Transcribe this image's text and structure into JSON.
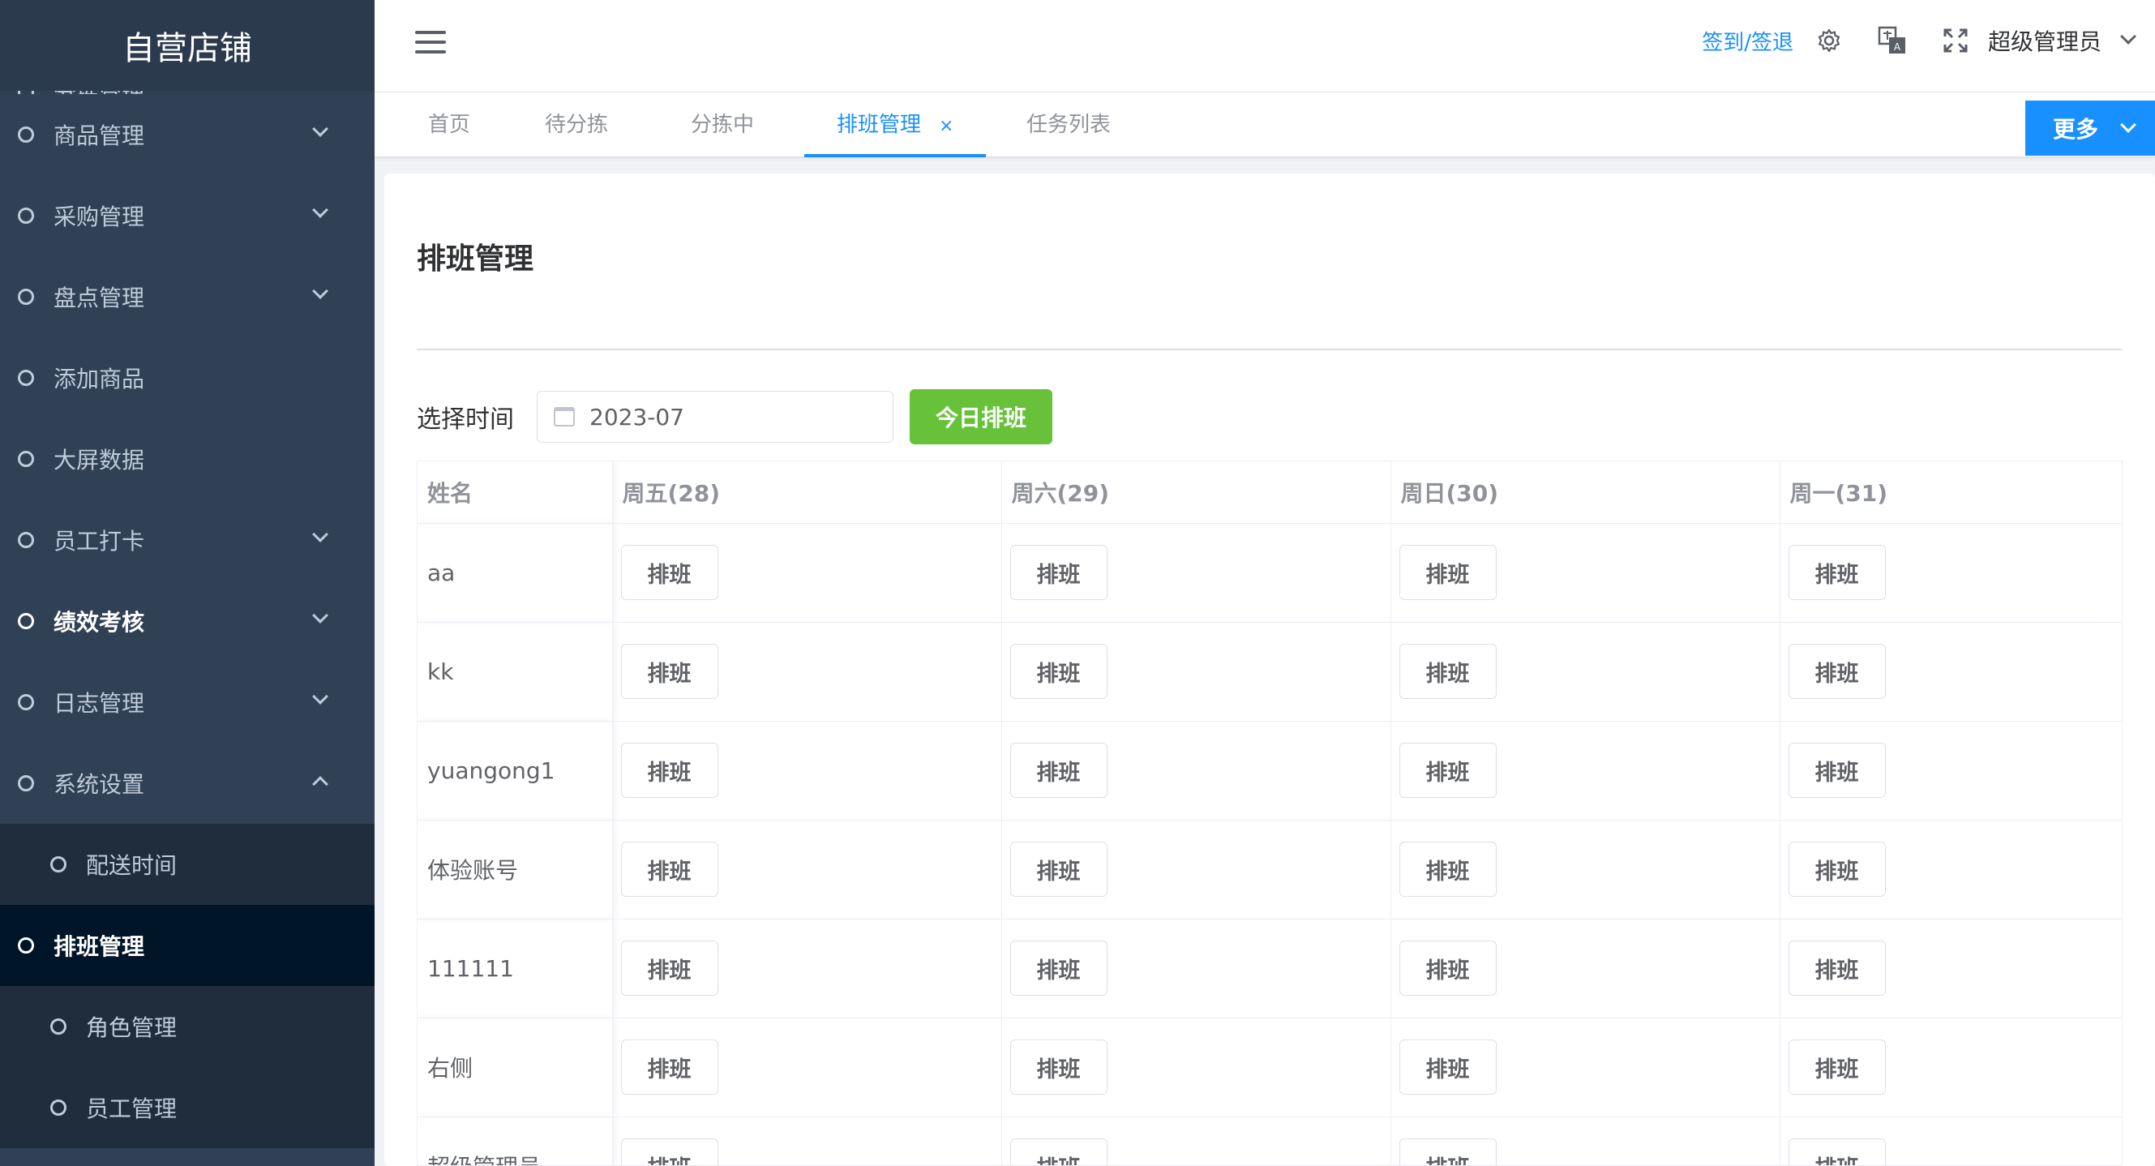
{
  "sidebar": {
    "logo": "自营店铺",
    "items": [
      {
        "label": "分拣管理",
        "chevron": "none",
        "state": "clipped"
      },
      {
        "label": "商品管理",
        "chevron": "down",
        "state": "normal"
      },
      {
        "label": "采购管理",
        "chevron": "down",
        "state": "normal"
      },
      {
        "label": "盘点管理",
        "chevron": "down",
        "state": "normal"
      },
      {
        "label": "添加商品",
        "chevron": "none",
        "state": "normal"
      },
      {
        "label": "大屏数据",
        "chevron": "none",
        "state": "normal"
      },
      {
        "label": "员工打卡",
        "chevron": "down",
        "state": "normal"
      },
      {
        "label": "绩效考核",
        "chevron": "down",
        "state": "strong"
      },
      {
        "label": "日志管理",
        "chevron": "down",
        "state": "normal"
      },
      {
        "label": "系统设置",
        "chevron": "up",
        "state": "normal"
      },
      {
        "label": "配送时间",
        "chevron": "none",
        "state": "sub"
      },
      {
        "label": "排班管理",
        "chevron": "none",
        "state": "active"
      },
      {
        "label": "角色管理",
        "chevron": "none",
        "state": "sub"
      },
      {
        "label": "员工管理",
        "chevron": "none",
        "state": "sub"
      }
    ]
  },
  "navbar": {
    "checkin_link": "签到/签退",
    "icons": [
      "gear-icon",
      "translate-icon",
      "fullscreen-icon"
    ],
    "user": "超级管理员"
  },
  "tags": {
    "items": [
      "首页",
      "待分拣",
      "分拣中",
      "排班管理",
      "任务列表"
    ],
    "active_index": 3,
    "close_symbol": "×",
    "more_label": "更多"
  },
  "page": {
    "title": "排班管理",
    "filter_label": "选择时间",
    "date_value": "2023-07",
    "today_button": "今日排班"
  },
  "table": {
    "headers": [
      "姓名",
      "周五(28)",
      "周六(29)",
      "周日(30)",
      "周一(31)"
    ],
    "rows": [
      "aa",
      "kk",
      "yuangong1",
      "体验账号",
      "111111",
      "右侧",
      "超级管理员"
    ],
    "cell_button": "排班"
  },
  "colors": {
    "sidebar_bg": "#304156",
    "primary": "#1890ff",
    "success": "#67c23a"
  }
}
